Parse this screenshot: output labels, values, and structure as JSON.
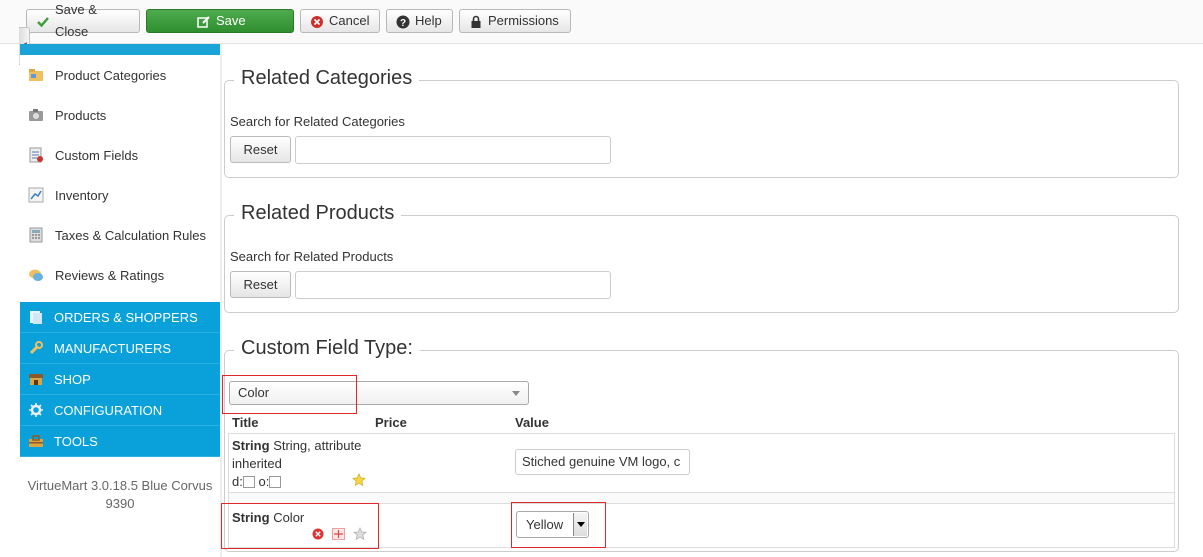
{
  "toolbar": {
    "save_close": "Save & Close",
    "save": "Save",
    "cancel": "Cancel",
    "help": "Help",
    "permissions": "Permissions"
  },
  "sidebar": {
    "items": [
      {
        "label": "Product Categories",
        "icon": "folder-icon"
      },
      {
        "label": "Products",
        "icon": "camera-icon"
      },
      {
        "label": "Custom Fields",
        "icon": "list-icon"
      },
      {
        "label": "Inventory",
        "icon": "chart-icon"
      },
      {
        "label": "Taxes & Calculation Rules",
        "icon": "calculator-icon"
      },
      {
        "label": "Reviews & Ratings",
        "icon": "speech-bubble-icon"
      }
    ],
    "sections": [
      {
        "label": "ORDERS & SHOPPERS",
        "icon": "orders-icon"
      },
      {
        "label": "MANUFACTURERS",
        "icon": "wrench-icon"
      },
      {
        "label": "SHOP",
        "icon": "shop-icon"
      },
      {
        "label": "CONFIGURATION",
        "icon": "configuration-icon"
      },
      {
        "label": "TOOLS",
        "icon": "toolbox-icon"
      }
    ],
    "version_line1": "VirtueMart 3.0.18.5 Blue Corvus",
    "version_line2": "9390"
  },
  "related_categories": {
    "legend": "Related Categories",
    "search_label": "Search for Related Categories",
    "reset": "Reset",
    "search_value": ""
  },
  "related_products": {
    "legend": "Related Products",
    "search_label": "Search for Related Products",
    "reset": "Reset",
    "search_value": ""
  },
  "custom_fields": {
    "legend": "Custom Field Type:",
    "selected_type": "Color",
    "columns": {
      "title": "Title",
      "price": "Price",
      "value": "Value"
    },
    "rows": [
      {
        "type": "String",
        "title": "String, attribute",
        "title_line2": "inherited",
        "d_label": "d:",
        "o_label": "o:",
        "value": "Stiched genuine VM logo, c"
      },
      {
        "type": "String",
        "title": "Color",
        "value": "Yellow"
      }
    ]
  },
  "colors": {
    "accent": "#0aa0da",
    "save_button": "#3a9c3a",
    "highlight_box": "#e0282c"
  }
}
